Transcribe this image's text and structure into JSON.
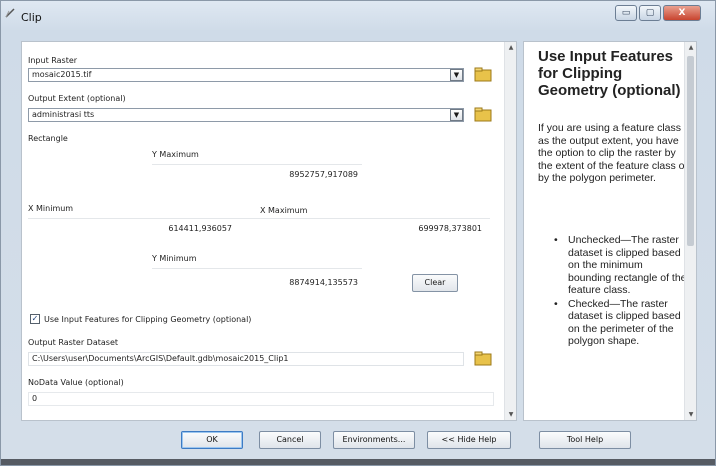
{
  "window": {
    "title": "Clip"
  },
  "title_controls": {
    "minimize": "▭",
    "maximize": "▢",
    "close": "X"
  },
  "form": {
    "input_raster": {
      "label": "Input Raster",
      "value": "mosaic2015.tif"
    },
    "output_extent": {
      "label": "Output Extent (optional)",
      "value": "administrasi tts"
    },
    "rectangle": {
      "label": "Rectangle",
      "y_max_label": "Y Maximum",
      "y_max": "8952757,917089",
      "x_min_label": "X Minimum",
      "x_min": "614411,936057",
      "x_max_label": "X Maximum",
      "x_max": "699978,373801",
      "y_min_label": "Y Minimum",
      "y_min": "8874914,135573",
      "clear_label": "Clear"
    },
    "use_input_features": {
      "checked": true,
      "check_glyph": "✓",
      "label": "Use Input Features for Clipping Geometry (optional)"
    },
    "output_raster": {
      "label": "Output Raster Dataset",
      "value": "C:\\Users\\user\\Documents\\ArcGIS\\Default.gdb\\mosaic2015_Clip1"
    },
    "nodata": {
      "label": "NoData Value (optional)",
      "value": "0"
    }
  },
  "help": {
    "title": "Use Input Features for Clipping Geometry (optional)",
    "body": "If you are using a feature class as the output extent, you have the option to clip the raster by the extent of the feature class or by the polygon perimeter.",
    "items": [
      {
        "bullet": "•",
        "text": "Unchecked—The raster dataset is clipped based on the minimum bounding rectangle of the feature class."
      },
      {
        "bullet": "•",
        "text": "Checked—The raster dataset is clipped based on the perimeter of the polygon shape."
      }
    ]
  },
  "buttons": {
    "ok": "OK",
    "cancel": "Cancel",
    "environments": "Environments...",
    "hide_help": "<< Hide Help",
    "tool_help": "Tool Help"
  },
  "icons": {
    "dropdown": "dropdown-arrow-icon",
    "folder": "folder-icon",
    "app": "clip-tool-icon"
  },
  "colors": {
    "accent": "#3d7bc4",
    "folder_yellow": "#e8c24a",
    "close_red": "#c8442f"
  }
}
